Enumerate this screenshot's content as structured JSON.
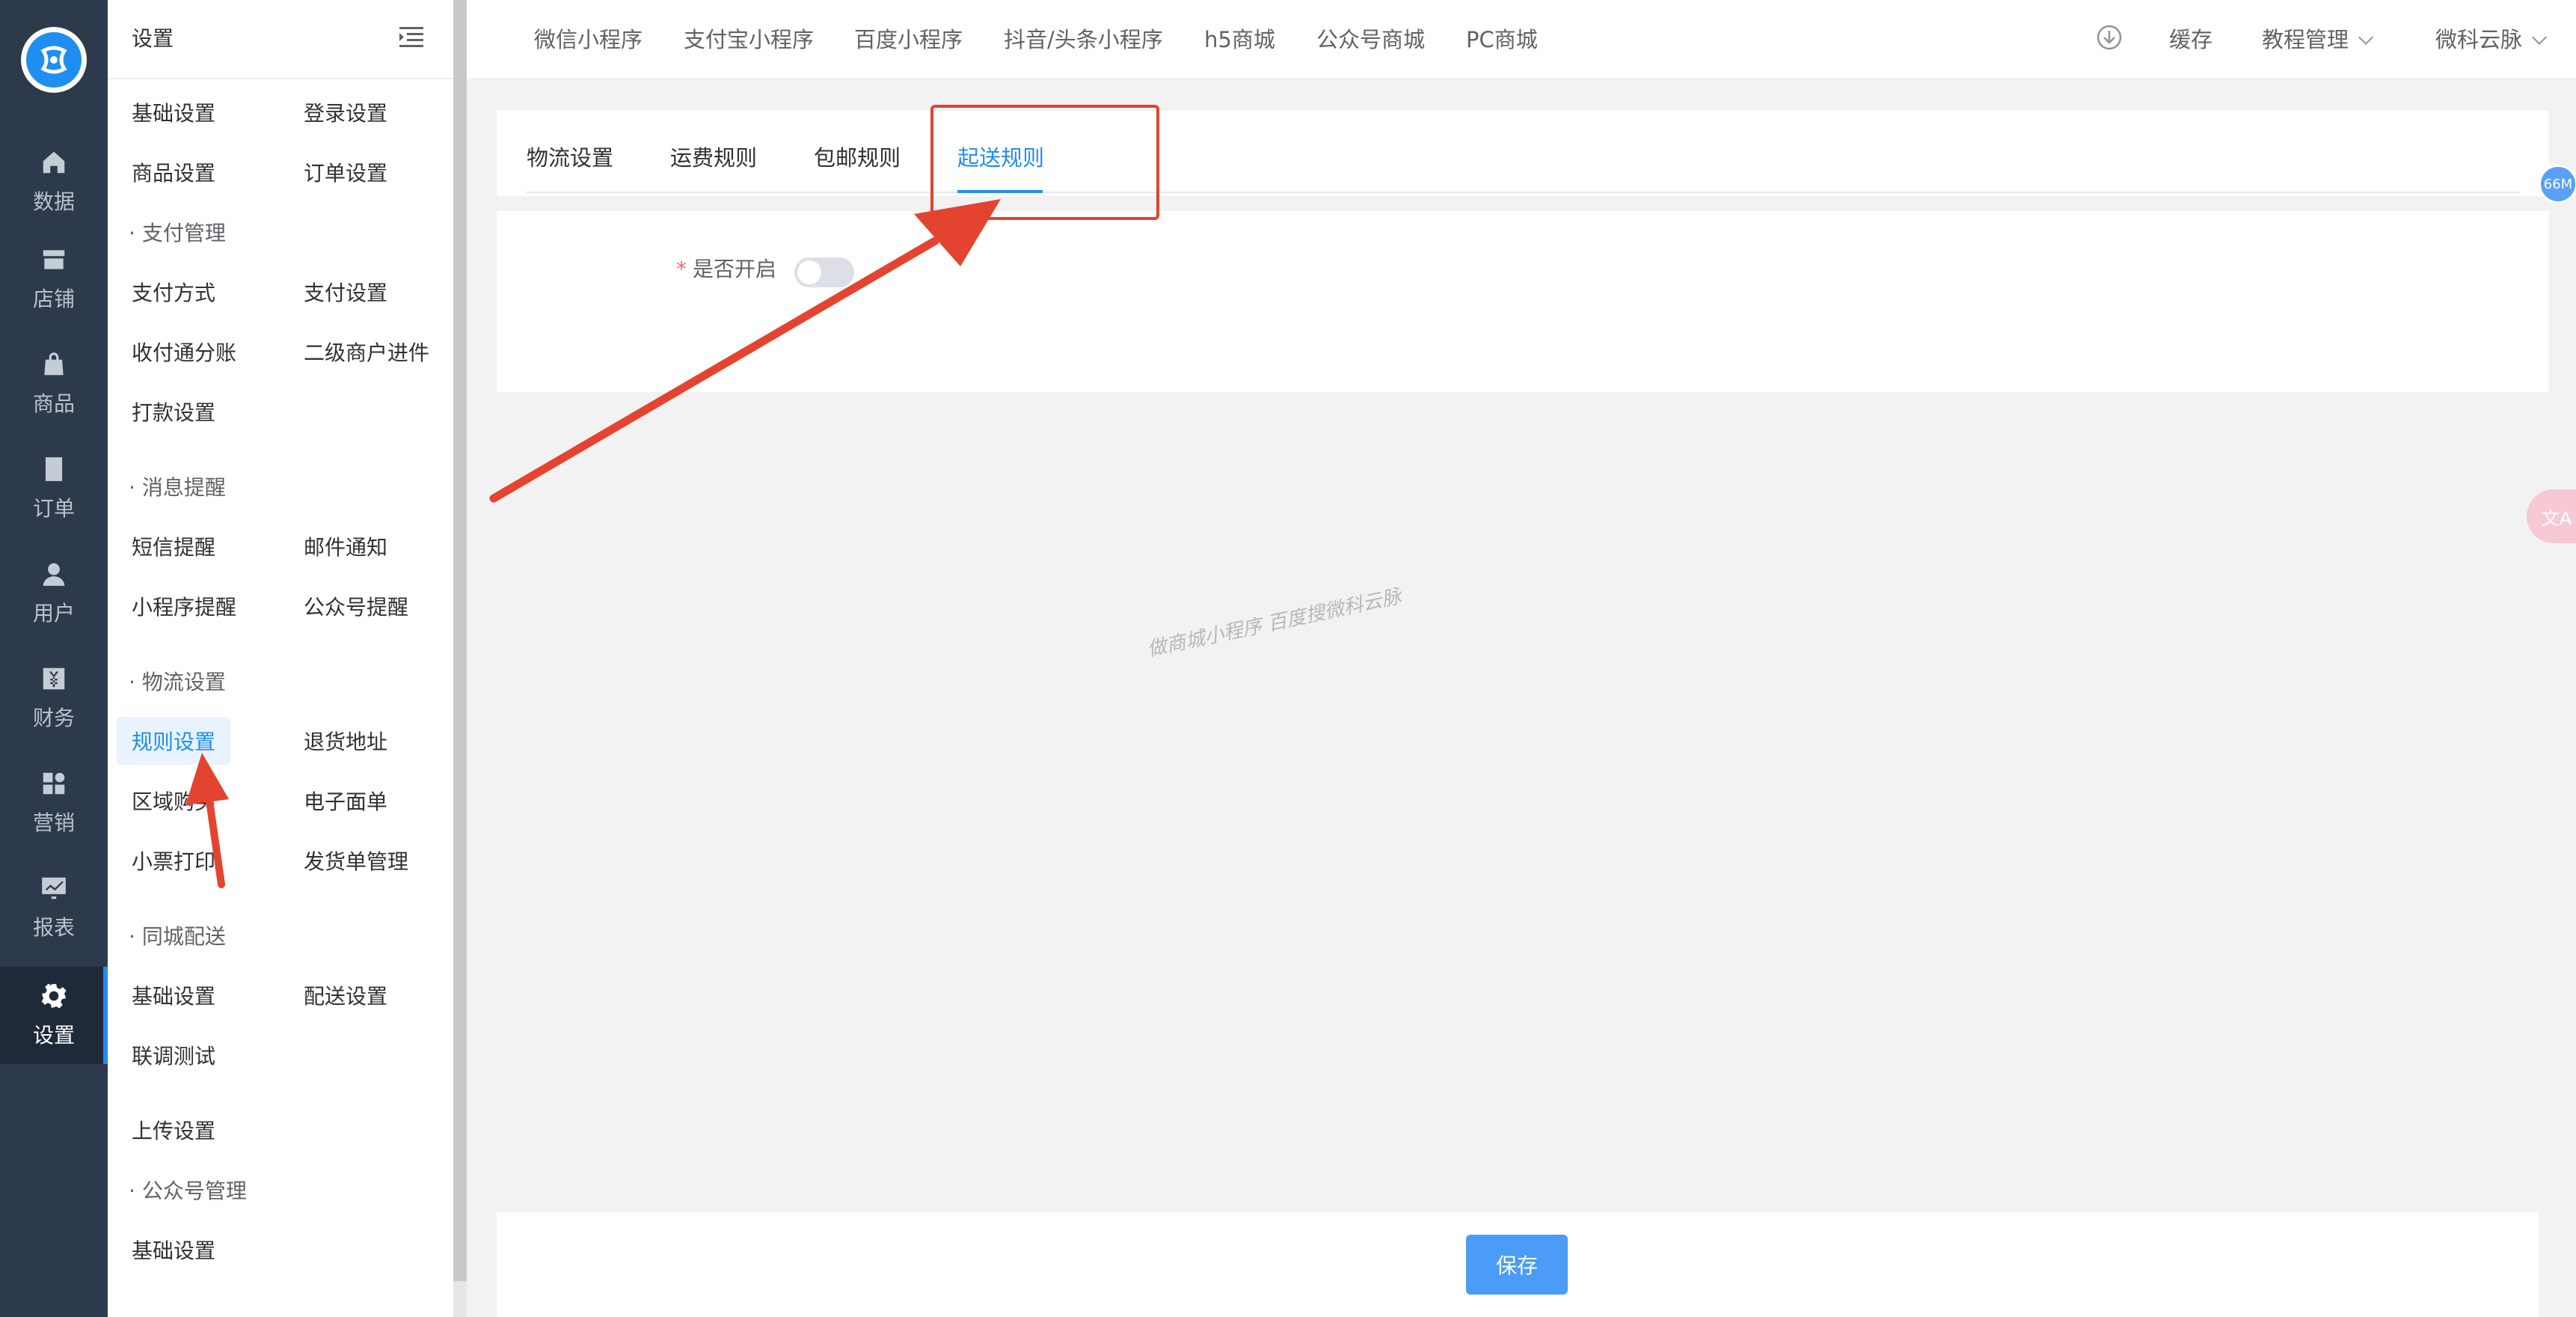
{
  "nav": {
    "items": [
      {
        "label": "数据",
        "icon": "home-icon"
      },
      {
        "label": "店铺",
        "icon": "store-icon"
      },
      {
        "label": "商品",
        "icon": "bag-icon"
      },
      {
        "label": "订单",
        "icon": "document-icon"
      },
      {
        "label": "用户",
        "icon": "user-icon"
      },
      {
        "label": "财务",
        "icon": "finance-icon"
      },
      {
        "label": "营销",
        "icon": "apps-icon"
      },
      {
        "label": "报表",
        "icon": "chart-icon"
      },
      {
        "label": "设置",
        "icon": "gear-icon"
      }
    ],
    "active": "设置"
  },
  "submenu": {
    "title": "设置",
    "items": {
      "basic": "基础设置",
      "login": "登录设置",
      "goods": "商品设置",
      "order": "订单设置",
      "group_pay": "支付管理",
      "pay_method": "支付方式",
      "pay_setting": "支付设置",
      "split": "收付通分账",
      "sub_merchant": "二级商户进件",
      "transfer": "打款设置",
      "group_msg": "消息提醒",
      "sms": "短信提醒",
      "email": "邮件通知",
      "mini_remind": "小程序提醒",
      "mp_remind": "公众号提醒",
      "group_logistics": "物流设置",
      "rules": "规则设置",
      "return_addr": "退货地址",
      "region_buy": "区域购买",
      "e_waybill": "电子面单",
      "ticket_print": "小票打印",
      "ship_manage": "发货单管理",
      "group_city": "同城配送",
      "city_basic": "基础设置",
      "city_delivery": "配送设置",
      "joint_test": "联调测试",
      "upload": "上传设置",
      "group_mp": "公众号管理",
      "mp_basic": "基础设置"
    }
  },
  "topbar": {
    "links": [
      "微信小程序",
      "支付宝小程序",
      "百度小程序",
      "抖音/头条小程序",
      "h5商城",
      "公众号商城",
      "PC商城"
    ],
    "cache": "缓存",
    "tutorial": "教程管理",
    "user": "微科云脉"
  },
  "tabs": [
    "物流设置",
    "运费规则",
    "包邮规则",
    "起送规则"
  ],
  "active_tab": "起送规则",
  "form": {
    "label": "是否开启",
    "required_mark": "*",
    "switch_on": false
  },
  "watermark": "做商城小程序 百度搜微科云脉",
  "floating": {
    "memory": "66M",
    "translate": "文A"
  },
  "footer": {
    "save_label": "保存"
  },
  "colors": {
    "primary": "#1f8ef1",
    "nav_bg": "#2d3a4b",
    "annotation": "#e4442f"
  }
}
